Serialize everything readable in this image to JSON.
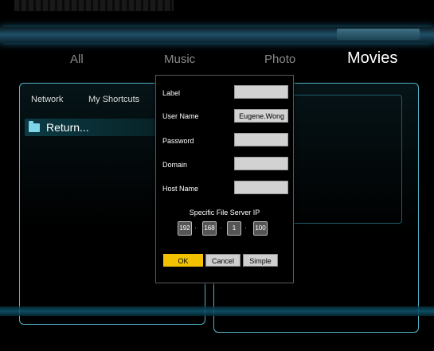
{
  "tabs": [
    {
      "label": "All"
    },
    {
      "label": "Music"
    },
    {
      "label": "Photo"
    },
    {
      "label": "Movies"
    }
  ],
  "left_panel": {
    "nav": [
      "Network",
      "My Shortcuts"
    ],
    "selected_item": "Return..."
  },
  "dialog": {
    "fields": [
      {
        "label": "Label",
        "value": ""
      },
      {
        "label": "User Name",
        "value": "Eugene.Wong"
      },
      {
        "label": "Password",
        "value": ""
      },
      {
        "label": "Domain",
        "value": ""
      },
      {
        "label": "Host Name",
        "value": ""
      }
    ],
    "ip_title": "Specific File Server IP",
    "ip": [
      "192",
      "168",
      "1",
      "100"
    ],
    "buttons": {
      "ok": "OK",
      "cancel": "Cancel",
      "simple": "Simple"
    }
  },
  "colors": {
    "accent": "#4fb3c6",
    "ok_button": "#f2c200"
  }
}
